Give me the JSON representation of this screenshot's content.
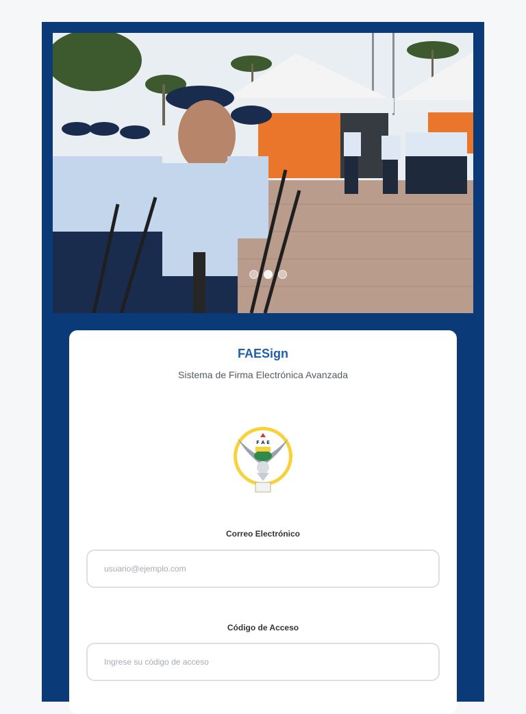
{
  "hero": {
    "image_description_icon": "parade-photo",
    "carousel": {
      "count": 3,
      "active_index": 1
    }
  },
  "login": {
    "app_title": "FAESign",
    "subtitle": "Sistema de Firma Electrónica Avanzada",
    "logo_text": "F A E",
    "email_label": "Correo Electrónico",
    "email_placeholder": "usuario@ejemplo.com",
    "email_value": "",
    "code_label": "Código de Acceso",
    "code_placeholder": "Ingrese su código de acceso",
    "code_value": ""
  },
  "colors": {
    "frame": "#0a3a78",
    "title": "#1f5fa8",
    "background": "#f6f7f9"
  }
}
